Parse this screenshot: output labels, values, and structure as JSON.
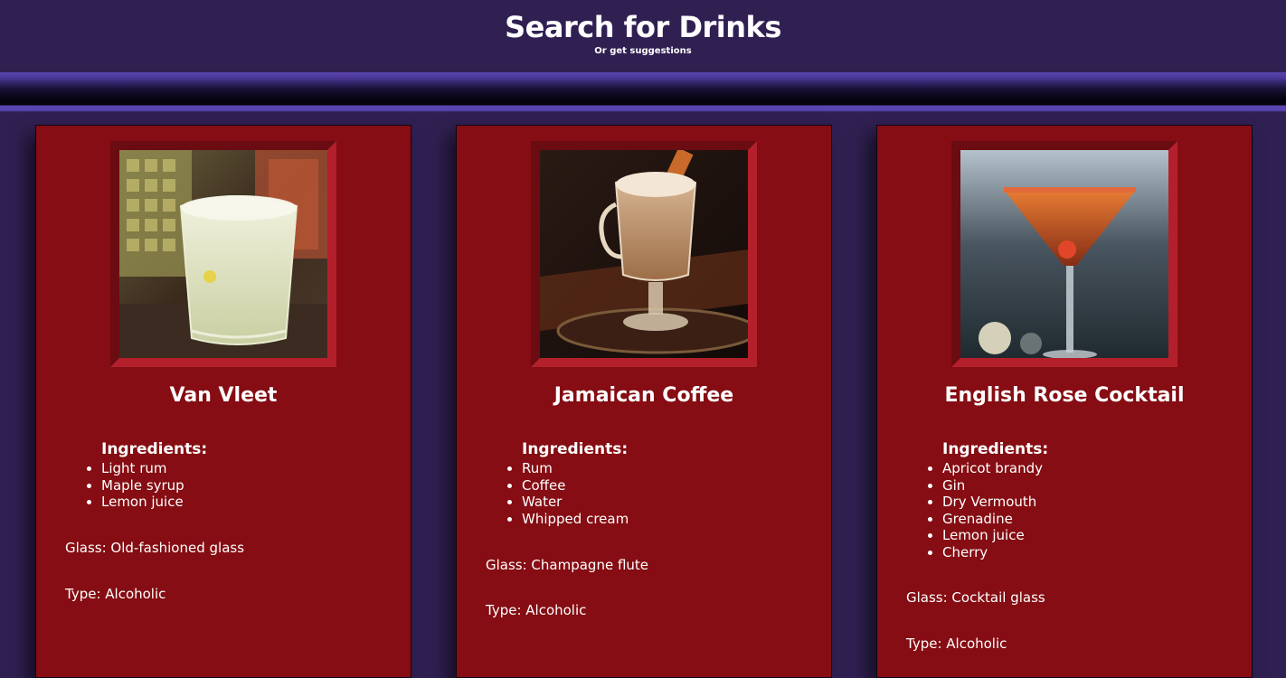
{
  "header": {
    "title": "Search for Drinks",
    "subtitle": "Or get suggestions"
  },
  "drinks": [
    {
      "name": "Van Vleet",
      "ingredients_label": "Ingredients:",
      "ingredients": [
        "Light rum",
        "Maple syrup",
        "Lemon juice"
      ],
      "glass": "Glass: Old-fashioned glass",
      "type": "Type: Alcoholic",
      "image_icon": "lemon-rum-cocktail-photo"
    },
    {
      "name": "Jamaican Coffee",
      "ingredients_label": "Ingredients:",
      "ingredients": [
        "Rum",
        "Coffee",
        "Water",
        "Whipped cream"
      ],
      "glass": "Glass: Champagne flute",
      "type": "Type: Alcoholic",
      "image_icon": "coffee-glass-photo"
    },
    {
      "name": "English Rose Cocktail",
      "ingredients_label": "Ingredients:",
      "ingredients": [
        "Apricot brandy",
        "Gin",
        "Dry Vermouth",
        "Grenadine",
        "Lemon juice",
        "Cherry"
      ],
      "glass": "Glass: Cocktail glass",
      "type": "Type: Alcoholic",
      "image_icon": "martini-glass-photo"
    }
  ],
  "colors": {
    "background": "#302052",
    "card": "#850d13",
    "accent_band": "#5a45b0",
    "frame_light": "#b3202b",
    "frame_dark": "#6b0b12"
  }
}
